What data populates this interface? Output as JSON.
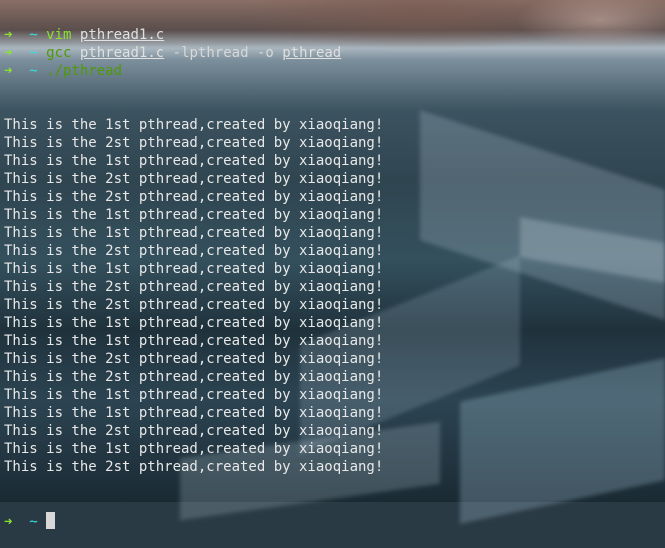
{
  "terminal": {
    "prompt_symbol": "➜",
    "cwd": "~",
    "commands": [
      {
        "program": "vim",
        "args": [
          {
            "text": "pthread1.c",
            "underline": true
          }
        ]
      },
      {
        "program": "gcc",
        "args": [
          {
            "text": "pthread1.c",
            "underline": true
          },
          {
            "text": "-lpthread",
            "underline": false
          },
          {
            "text": "-o",
            "underline": false
          },
          {
            "text": "pthread",
            "underline": true
          }
        ]
      },
      {
        "program": "./pthread",
        "args": []
      }
    ],
    "output_lines": [
      "This is the 1st pthread,created by xiaoqiang!",
      "This is the 2st pthread,created by xiaoqiang!",
      "This is the 1st pthread,created by xiaoqiang!",
      "This is the 2st pthread,created by xiaoqiang!",
      "This is the 2st pthread,created by xiaoqiang!",
      "This is the 1st pthread,created by xiaoqiang!",
      "This is the 1st pthread,created by xiaoqiang!",
      "This is the 2st pthread,created by xiaoqiang!",
      "This is the 1st pthread,created by xiaoqiang!",
      "This is the 2st pthread,created by xiaoqiang!",
      "This is the 2st pthread,created by xiaoqiang!",
      "This is the 1st pthread,created by xiaoqiang!",
      "This is the 1st pthread,created by xiaoqiang!",
      "This is the 2st pthread,created by xiaoqiang!",
      "This is the 2st pthread,created by xiaoqiang!",
      "This is the 1st pthread,created by xiaoqiang!",
      "This is the 1st pthread,created by xiaoqiang!",
      "This is the 2st pthread,created by xiaoqiang!",
      "This is the 1st pthread,created by xiaoqiang!",
      "This is the 2st pthread,created by xiaoqiang!"
    ],
    "colors": {
      "arrow": "#8ae234",
      "tilde": "#34e2e2",
      "output": "#e8e8e8",
      "cursor": "#d8d8d8"
    }
  }
}
